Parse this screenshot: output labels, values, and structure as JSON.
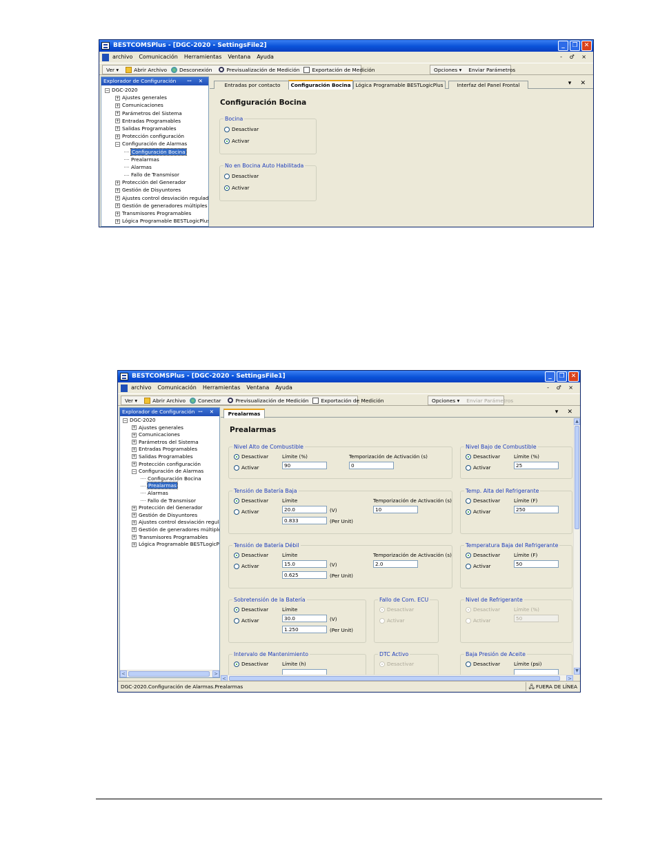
{
  "common": {
    "menu": [
      "archivo",
      "Comunicación",
      "Herramientas",
      "Ventana",
      "Ayuda"
    ],
    "mdi_controls": "- ♂ ×",
    "toolbar": {
      "ver": "Ver ▾",
      "abrir": "Abrir Archivo",
      "desconexion": "Desconexión",
      "conectar": "Conectar",
      "preview": "Previsualización de Medición",
      "export": "Exportación de Medición",
      "opciones": "Opciones ▾",
      "enviar": "Enviar Parámetros"
    },
    "explorer_title": "Explorador de Configuración",
    "explorer_pin": "ꟷ ✕",
    "tree": {
      "root": "DGC-2020",
      "ajustes": "Ajustes generales",
      "comunicaciones": "Comunicaciones",
      "parametros": "Parámetros del Sistema",
      "entradas": "Entradas Programables",
      "salidas": "Salidas Programables",
      "proteccion_conf": "Protección configuración",
      "alarmas_conf": "Configuración de Alarmas",
      "bocina": "Configuración Bocina",
      "prealarmas": "Prealarmas",
      "alarmas": "Alarmas",
      "fallo": "Fallo de Transmisor",
      "prot_gen": "Protección del Generador",
      "disyuntores": "Gestión de Disyuntores",
      "desviacion": "Ajustes control desviación regulador",
      "multiples": "Gestión de generadores múltiples",
      "transmisores": "Transmisores Programables",
      "logica": "Lógica Programable BESTLogicPlus"
    }
  },
  "window1": {
    "title": "BESTCOMSPlus - [DGC-2020 - SettingsFile2]",
    "tabs": [
      "Entradas por contacto",
      "Configuración Bocina",
      "Lógica Programable BESTLogicPlus",
      "Interfaz del Panel Frontal"
    ],
    "tab_controls": "▾ ✕",
    "heading": "Configuración Bocina",
    "group1": {
      "title": "Bocina",
      "opt_off": "Desactivar",
      "opt_on": "Activar"
    },
    "group2": {
      "title": "No en Bocina Auto Habilitada",
      "opt_off": "Desactivar",
      "opt_on": "Activar"
    }
  },
  "window2": {
    "title": "BESTCOMSPlus - [DGC-2020 - SettingsFile1]",
    "tab": "Prealarmas",
    "tab_controls": "▾ ✕",
    "heading": "Prealarmas",
    "labels": {
      "desactivar": "Desactivar",
      "activar": "Activar",
      "limite": "Límite",
      "limite_pct": "Límite (%)",
      "limite_f": "Límite (F)",
      "limite_h": "Límite (h)",
      "limite_psi": "Límite (psi)",
      "temporizacion": "Temporización de Activación (s)",
      "volts": "(V)",
      "per_unit": "(Per Unit)"
    },
    "groups": {
      "nivel_alto": {
        "title": "Nivel Alto de Combustible",
        "limit": "90",
        "delay": "0"
      },
      "nivel_bajo": {
        "title": "Nivel Bajo de Combustible",
        "limit": "25"
      },
      "bat_baja": {
        "title": "Tensión de Batería Baja",
        "limit_v": "20.0",
        "limit_pu": "0.833",
        "delay": "10"
      },
      "temp_alta": {
        "title": "Temp. Alta del Refrigerante",
        "limit": "250"
      },
      "bat_debil": {
        "title": "Tensión de Batería Débil",
        "limit_v": "15.0",
        "limit_pu": "0.625",
        "delay": "2.0"
      },
      "temp_baja": {
        "title": "Temperatura Baja del Refrigerante",
        "limit": "50"
      },
      "sobretension": {
        "title": "Sobretensión de la Batería",
        "limit_v": "30.0",
        "limit_pu": "1.250"
      },
      "fallo_ecu": {
        "title": "Fallo de Com. ECU"
      },
      "nivel_refrig": {
        "title": "Nivel de Refrigerante",
        "limit": "50"
      },
      "mantenimiento": {
        "title": "Intervalo de Mantenimiento"
      },
      "dtc": {
        "title": "DTC Activo"
      },
      "baja_presion": {
        "title": "Baja Presión de Aceite"
      }
    },
    "status": "DGC-2020.Configuración de Alarmas.Prealarmas",
    "status_right": "FUERA DE LÍNEA"
  }
}
